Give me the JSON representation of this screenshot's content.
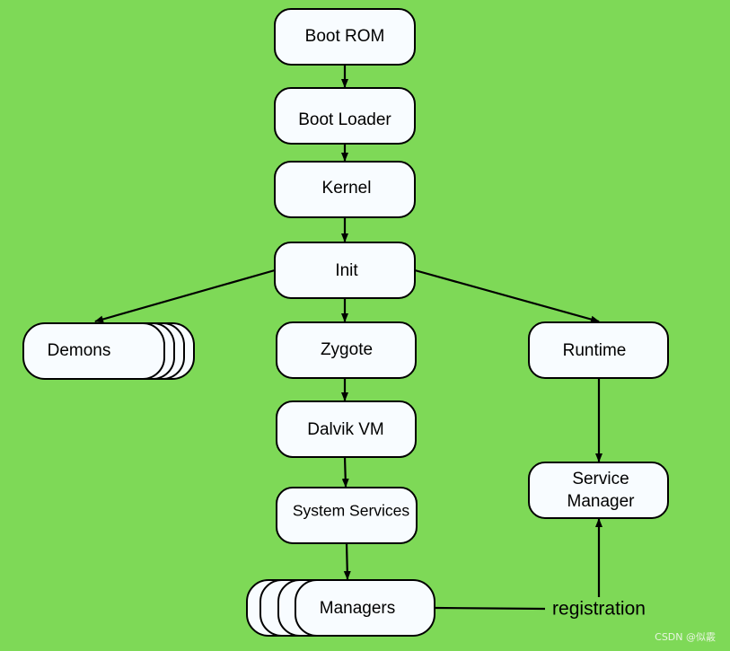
{
  "colors": {
    "background": "#7ed957",
    "box_fill": "#f8fcff",
    "stroke": "#000000"
  },
  "nodes": {
    "boot_rom": "Boot ROM",
    "boot_loader": "Boot Loader",
    "kernel": "Kernel",
    "init": "Init",
    "demons": "Demons",
    "zygote": "Zygote",
    "runtime": "Runtime",
    "dalvik_vm": "Dalvik VM",
    "system_services": "System Services",
    "service_manager_line1": "Service",
    "service_manager_line2": "Manager",
    "managers": "Managers"
  },
  "edge_labels": {
    "registration": "registration"
  },
  "watermark": "CSDN @似霰"
}
